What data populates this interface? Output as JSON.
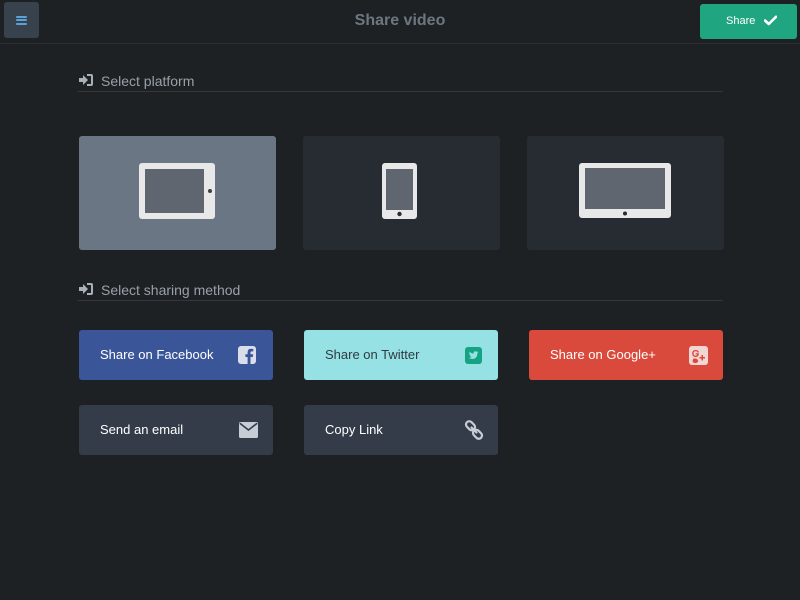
{
  "header": {
    "title": "Share video",
    "share_label": "Share"
  },
  "sections": {
    "platform_label": "Select platform",
    "method_label": "Select sharing method"
  },
  "platforms": [
    {
      "device": "tablet-landscape",
      "selected": true
    },
    {
      "device": "phone-portrait",
      "selected": false
    },
    {
      "device": "tablet-landscape-wide",
      "selected": false
    }
  ],
  "methods": [
    {
      "label": "Share on Facebook",
      "icon": "facebook-icon",
      "color": "#3a5698"
    },
    {
      "label": "Share on Twitter",
      "icon": "twitter-icon",
      "color": "#96e1e3"
    },
    {
      "label": "Share on Google+",
      "icon": "google-plus-icon",
      "color": "#d94a3c"
    },
    {
      "label": "Send an email",
      "icon": "envelope-icon",
      "color": "#333c48"
    },
    {
      "label": "Copy Link",
      "icon": "link-icon",
      "color": "#333c48"
    }
  ],
  "colors": {
    "background": "#1e2124",
    "accent": "#1fa57f",
    "selected_tile": "#6b7685",
    "tile": "#272c33"
  }
}
